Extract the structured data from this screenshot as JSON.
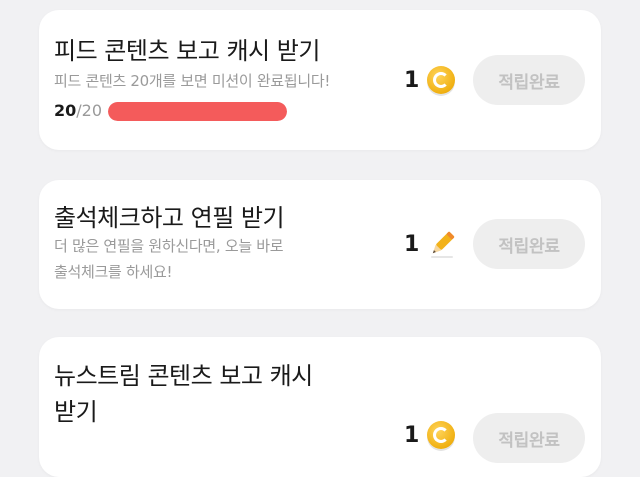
{
  "missions": [
    {
      "title": "피드 콘텐츠 보고 캐시 받기",
      "description": "피드 콘텐츠 20개를 보면 미션이 완료됩니다!",
      "progress": {
        "current": "20",
        "separator": "/",
        "total": "20",
        "fraction": 1.0
      },
      "reward_count": "1",
      "reward_icon": "coin-icon",
      "button_label": "적립완료"
    },
    {
      "title": "출석체크하고 연필 받기",
      "description_line1": "더 많은 연필을 원하신다면, 오늘 바로",
      "description_line2": "출석체크를 하세요!",
      "reward_count": "1",
      "reward_icon": "pencil-icon",
      "button_label": "적립완료"
    },
    {
      "title_line1": "뉴스트림 콘텐츠 보고 캐시",
      "title_line2": "받기",
      "reward_count": "1",
      "reward_icon": "coin-icon",
      "button_label": "적립완료"
    }
  ],
  "colors": {
    "progress_fill": "#f45b5b",
    "coin": "#f2b21a",
    "button_bg": "#eeeeee",
    "button_text": "#c2c2c2"
  }
}
